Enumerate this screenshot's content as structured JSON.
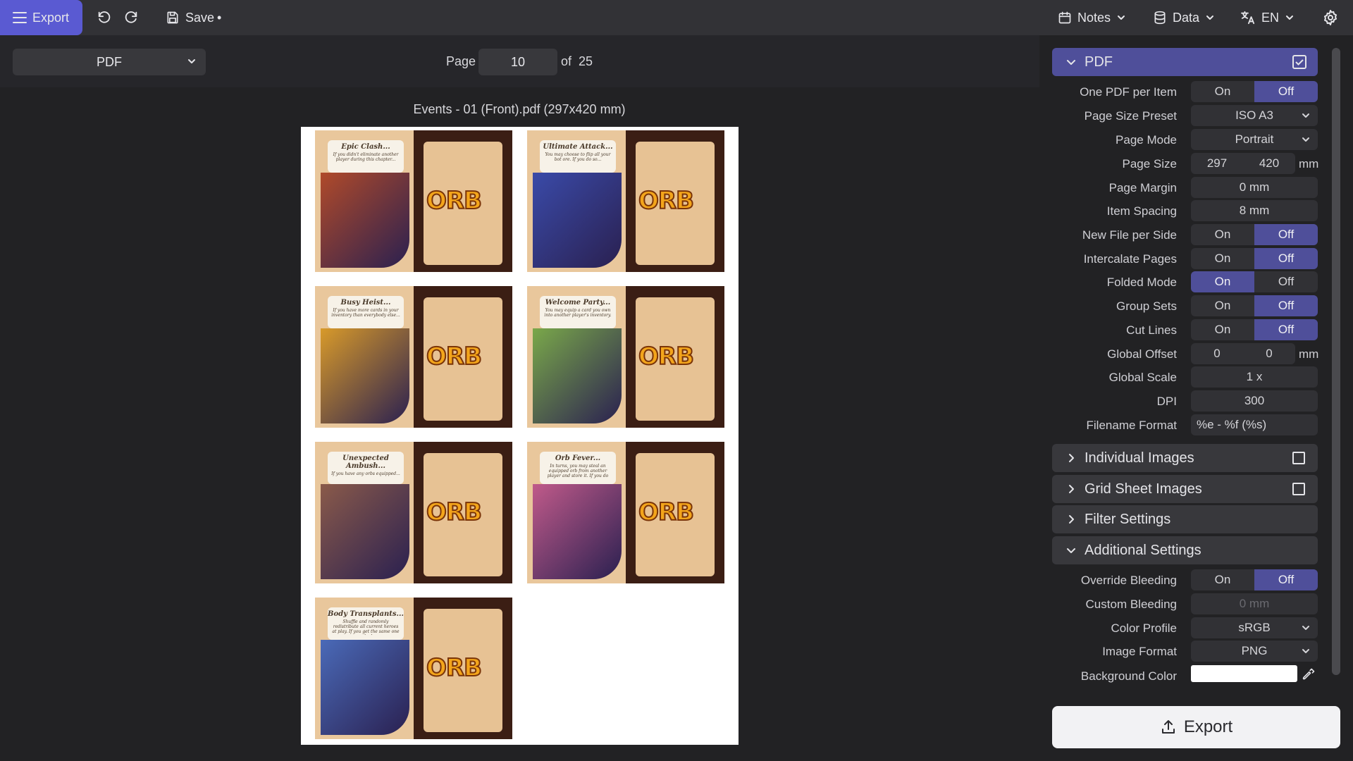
{
  "topbar": {
    "export_label": "Export",
    "save_label": "Save",
    "save_dirty": "•",
    "notes_label": "Notes",
    "data_label": "Data",
    "lang_label": "EN"
  },
  "toolbar": {
    "format_selected": "PDF",
    "page_label": "Page",
    "page_value": "10",
    "of_label": "of",
    "page_total": "25"
  },
  "preview": {
    "title": "Events - 01 (Front).pdf (297x420 mm)",
    "cards": [
      {
        "title": "Epic Clash...",
        "text": "If you didn't eliminate another player during this chapter...",
        "logo": "ORB",
        "art_color": "#b04a2a"
      },
      {
        "title": "Ultimate Attack...",
        "text": "You may choose to flip all your bot ore. If you do so...",
        "logo": "ORB",
        "art_color": "#3a4aa8"
      },
      {
        "title": "Busy Heist...",
        "text": "If you have more cards in your inventory than everybody else...",
        "logo": "ORB",
        "art_color": "#d89a2a"
      },
      {
        "title": "Welcome Party...",
        "text": "You may equip a card you own into another player's inventory.",
        "logo": "ORB",
        "art_color": "#7aa84a"
      },
      {
        "title": "Unexpected Ambush...",
        "text": "If you have any orbs equipped...",
        "logo": "ORB",
        "art_color": "#8a5a4a"
      },
      {
        "title": "Orb Fever...",
        "text": "In turns, you may steal an equipped orb from another player and store it. If you do so...",
        "logo": "ORB",
        "art_color": "#c05a8a"
      },
      {
        "title": "Body Transplants...",
        "text": "Shuffle and randomly redistribute all current heroes at play. If you get the same one you had...",
        "logo": "ORB",
        "art_color": "#4a6ab8"
      }
    ]
  },
  "panel": {
    "pdf_section": "PDF",
    "rows": {
      "one_pdf": {
        "label": "One PDF per Item",
        "on": "On",
        "off": "Off",
        "state": "off"
      },
      "page_size_preset": {
        "label": "Page Size Preset",
        "value": "ISO A3"
      },
      "page_mode": {
        "label": "Page Mode",
        "value": "Portrait"
      },
      "page_size": {
        "label": "Page Size",
        "w": "297",
        "h": "420",
        "unit": "mm"
      },
      "page_margin": {
        "label": "Page Margin",
        "value": "0 mm"
      },
      "item_spacing": {
        "label": "Item Spacing",
        "value": "8 mm"
      },
      "new_file_per_side": {
        "label": "New File per Side",
        "on": "On",
        "off": "Off",
        "state": "off"
      },
      "intercalate": {
        "label": "Intercalate Pages",
        "on": "On",
        "off": "Off",
        "state": "off"
      },
      "folded": {
        "label": "Folded Mode",
        "on": "On",
        "off": "Off",
        "state": "on"
      },
      "group_sets": {
        "label": "Group Sets",
        "on": "On",
        "off": "Off",
        "state": "off"
      },
      "cut_lines": {
        "label": "Cut Lines",
        "on": "On",
        "off": "Off",
        "state": "off"
      },
      "global_offset": {
        "label": "Global Offset",
        "x": "0",
        "y": "0",
        "unit": "mm"
      },
      "global_scale": {
        "label": "Global Scale",
        "value": "1 x"
      },
      "dpi": {
        "label": "DPI",
        "value": "300"
      },
      "filename_format": {
        "label": "Filename Format",
        "value": "%e - %f (%s)"
      }
    },
    "individual_images": "Individual Images",
    "grid_sheet_images": "Grid Sheet Images",
    "filter_settings": "Filter Settings",
    "additional_settings": "Additional Settings",
    "add_rows": {
      "override_bleeding": {
        "label": "Override Bleeding",
        "on": "On",
        "off": "Off",
        "state": "off"
      },
      "custom_bleeding": {
        "label": "Custom Bleeding",
        "value": "0 mm"
      },
      "color_profile": {
        "label": "Color Profile",
        "value": "sRGB"
      },
      "image_format": {
        "label": "Image Format",
        "value": "PNG"
      },
      "background_color": {
        "label": "Background Color",
        "value": "#ffffff"
      }
    },
    "export_label": "Export"
  },
  "colors": {
    "accent": "#5a5ad2",
    "toggle_active": "#4f4f9a",
    "background": "#222224"
  }
}
